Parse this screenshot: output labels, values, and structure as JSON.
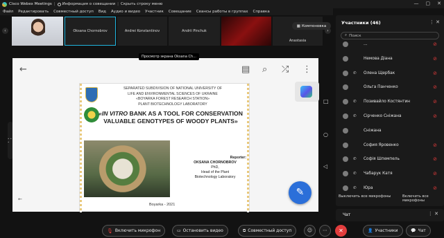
{
  "titlebar": {
    "app_name": "Cisco Webex Meetings",
    "info_label": "Информация о совещании",
    "hide_label": "Скрыть строку меню",
    "window_controls": [
      "—",
      "▢",
      "✕"
    ]
  },
  "menubar": {
    "items": [
      "Файл",
      "Редактировать",
      "Совместный доступ",
      "Вид",
      "Аудио и видео",
      "Участник",
      "Совещание",
      "Сеансы работы в группах",
      "Справка"
    ]
  },
  "filmstrip": {
    "tiles": [
      "",
      "Oksana Chornobrov",
      "Andrei Konstantinov",
      "Andrii Pinchuk",
      "",
      "Anastasia"
    ],
    "layout_button": "Компоновка",
    "prev_arrow": "‹",
    "next_arrow": "›"
  },
  "tooltip": "Просмотр экрана Oksana Ch...",
  "phone_side_icons": "• • •",
  "slide": {
    "org_lines": [
      "SEPARATED SUBDIVISION OF NATIONAL UNIVERSITY OF",
      "LIFE AND ENVIRONMENTAL SCIENCES OF UKRAINE",
      "«BOYARKA FOREST RESEARCH STATION»",
      "PLANT BIOTECHNOLOGY LABORATORY"
    ],
    "title_italic": "«IN VITRO",
    "title_rest": " BANK AS A TOOL FOR CONSERVATION VALUABLE GENOTYPES OF WOODY PLANTS»",
    "reporter_label": "Reporter:",
    "reporter_name": "OKSANA CHORNOBROV",
    "reporter_degree": "PhD,",
    "reporter_role_1": "Head of the Plant",
    "reporter_role_2": "Biotechnology Laboratory",
    "footer": "Boyarka - 2021"
  },
  "android_icons": {
    "back": "←",
    "doc": "▤",
    "search": "⌕",
    "share": "⤮",
    "more": "⋮",
    "edit": "✎",
    "small_back": "←",
    "nav_square": "□",
    "nav_circle": "○",
    "nav_triangle": "◁"
  },
  "participants_panel": {
    "header": "Участники (46)",
    "header_ctl": "⋮  ✕",
    "search_placeholder": "Поиск",
    "rows": [
      {
        "name": "...",
        "phone": false,
        "muted": true
      },
      {
        "name": "Немова Діана",
        "phone": false,
        "muted": true
      },
      {
        "name": "Олена Щербак",
        "phone": true,
        "muted": true
      },
      {
        "name": "Ольга Панченко",
        "phone": false,
        "muted": true
      },
      {
        "name": "Позивайло Костянтин",
        "phone": true,
        "muted": true
      },
      {
        "name": "Сірченко Сніжана",
        "phone": true,
        "muted": true
      },
      {
        "name": "Сніжана",
        "phone": false,
        "muted": false
      },
      {
        "name": "София Яровенко",
        "phone": false,
        "muted": true
      },
      {
        "name": "Софія Шпемпель",
        "phone": true,
        "muted": true
      },
      {
        "name": "Чабарук Катя",
        "phone": true,
        "muted": true
      },
      {
        "name": "Юра",
        "phone": true,
        "muted": true
      }
    ],
    "mute_all": "Выключить все микрофоны",
    "unmute_all": "Включить все микрофоны"
  },
  "chat_panel": {
    "label": "Чат",
    "ctl": "⋮  ✕"
  },
  "bottombar": {
    "mic": "Включить микрофон",
    "video": "Остановить видео",
    "share": "Совместный доступ",
    "participants": "Участники",
    "chat": "Чат",
    "end": "✕",
    "more": "⋯",
    "reactions": "☺"
  },
  "colors": {
    "accent": "#1fb6e0",
    "danger": "#e23d3d",
    "fab": "#2b6fd9"
  }
}
